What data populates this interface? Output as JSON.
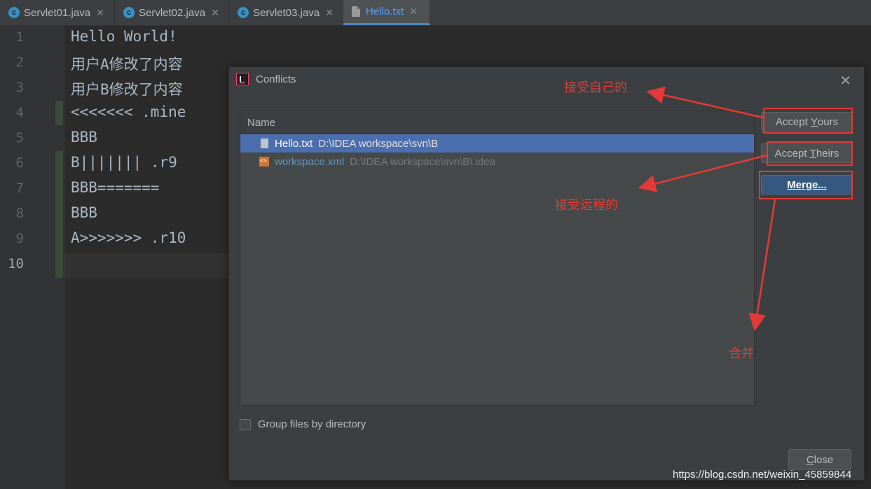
{
  "tabs": [
    {
      "label": "Servlet01.java",
      "icon": "java-class-icon",
      "active": false
    },
    {
      "label": "Servlet02.java",
      "icon": "java-class-icon",
      "active": false
    },
    {
      "label": "Servlet03.java",
      "icon": "java-class-icon",
      "active": false
    },
    {
      "label": "Hello.txt",
      "icon": "text-file-icon",
      "active": true
    }
  ],
  "editor": {
    "line_numbers": [
      "1",
      "2",
      "3",
      "4",
      "5",
      "6",
      "7",
      "8",
      "9",
      "10"
    ],
    "current_line": "10",
    "lines": [
      "Hello World!",
      "用户A修改了内容",
      "用户B修改了内容",
      "<<<<<<< .mine",
      "BBB",
      "B||||||| .r9",
      "BBB=======",
      "BBB",
      "A>>>>>>> .r10",
      ""
    ]
  },
  "dialog": {
    "title": "Conflicts",
    "column_header": "Name",
    "files": [
      {
        "name": "Hello.txt",
        "path": "D:\\IDEA workspace\\svn\\B",
        "selected": true
      },
      {
        "name": "workspace.xml",
        "path": "D:\\IDEA workspace\\svn\\B\\.idea",
        "selected": false
      }
    ],
    "buttons": {
      "accept_yours_pre": "Accept ",
      "accept_yours_mn": "Y",
      "accept_yours_post": "ours",
      "accept_theirs_pre": "Accept ",
      "accept_theirs_mn": "T",
      "accept_theirs_post": "heirs",
      "merge_mn": "M",
      "merge_post": "erge...",
      "close_mn": "C",
      "close_post": "lose"
    },
    "group_checkbox_label": "Group files by directory",
    "group_checked": false
  },
  "annotations": {
    "accept_yours_note": "接受自己的",
    "accept_theirs_note": "接受远程的",
    "merge_note": "合并"
  },
  "watermark": "https://blog.csdn.net/weixin_45859844",
  "colors": {
    "annotation": "#e53935",
    "selection": "#4b6eaf",
    "primary_button": "#365880"
  }
}
